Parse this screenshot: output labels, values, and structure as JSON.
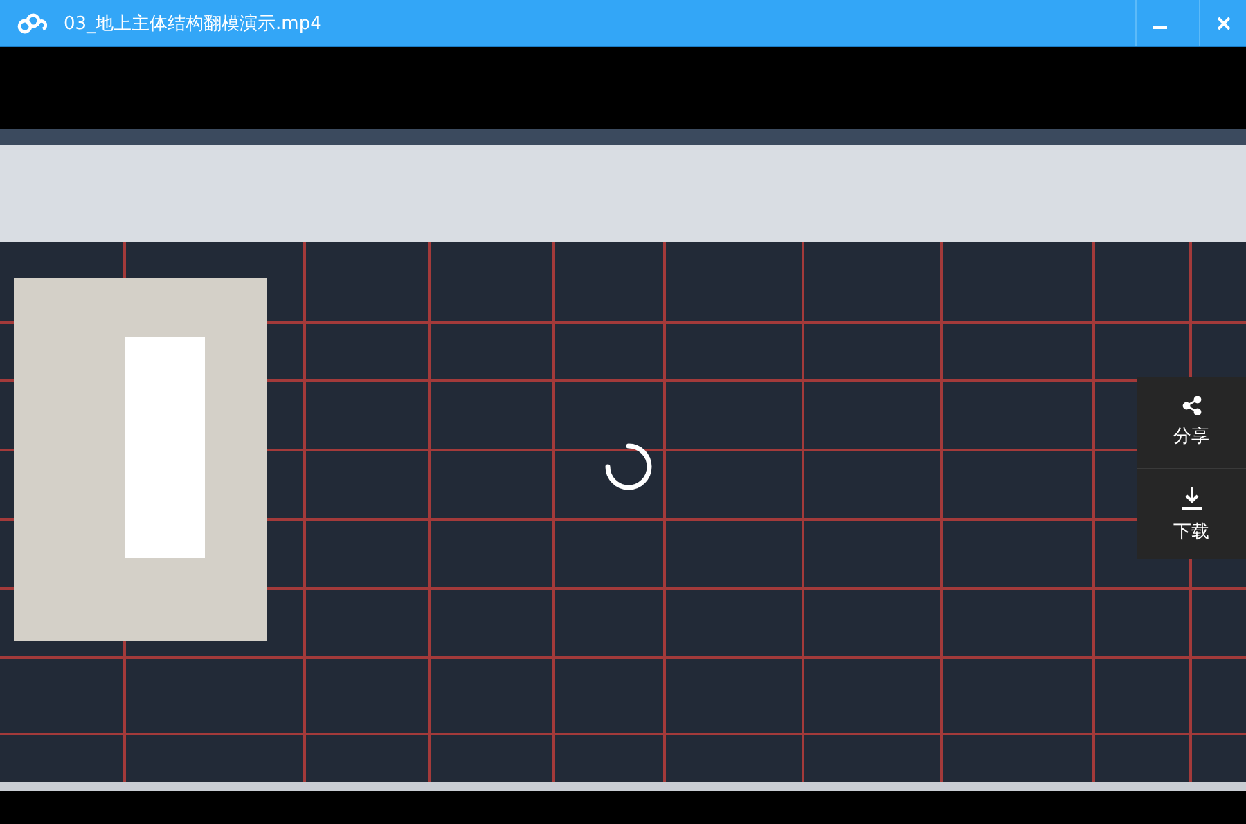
{
  "window": {
    "title": "03_地上主体结构翻模演示.mp4"
  },
  "video": {
    "loading": true
  },
  "side_actions": [
    {
      "kind": "share",
      "label": "分享"
    },
    {
      "kind": "download",
      "label": "下载"
    }
  ]
}
